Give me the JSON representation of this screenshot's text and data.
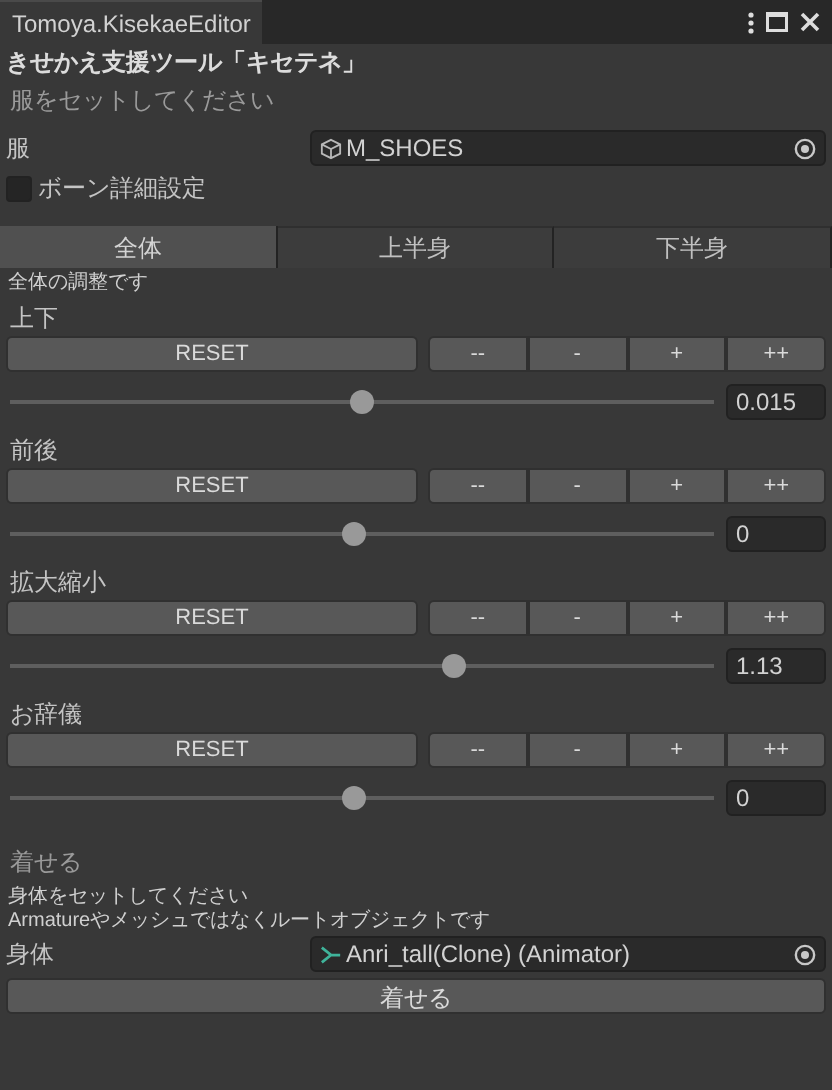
{
  "window": {
    "title": "Tomoya.KisekaeEditor"
  },
  "heading": "きせかえ支援ツール「キセテネ」",
  "clothes_hint": "服をセットしてください",
  "clothes_field": {
    "label": "服",
    "value": "M_SHOES"
  },
  "bone_setting": {
    "label": "ボーン詳細設定",
    "checked": false
  },
  "tabs": [
    {
      "label": "全体",
      "selected": true
    },
    {
      "label": "上半身",
      "selected": false
    },
    {
      "label": "下半身",
      "selected": false
    }
  ],
  "tab_note": "全体の調整です",
  "adjustments": [
    {
      "label": "上下",
      "buttons": [
        "RESET",
        "--",
        "-",
        "+",
        "++"
      ],
      "level": 0.5,
      "value": "0.015"
    },
    {
      "label": "前後",
      "buttons": [
        "RESET",
        "--",
        "-",
        "+",
        "++"
      ],
      "level": 0.49,
      "value": "0"
    },
    {
      "label": "拡大縮小",
      "buttons": [
        "RESET",
        "--",
        "-",
        "+",
        "++"
      ],
      "level": 0.63,
      "value": "1.13"
    },
    {
      "label": "お辞儀",
      "buttons": [
        "RESET",
        "--",
        "-",
        "+",
        "++"
      ],
      "level": 0.49,
      "value": "0"
    }
  ],
  "dress_section": {
    "title": "着せる",
    "hints": [
      "身体をセットしてください",
      "Armatureやメッシュではなくルートオブジェクトです"
    ],
    "body_field": {
      "label": "身体",
      "value": "Anri_tall(Clone) (Animator)"
    },
    "button": "着せる"
  }
}
